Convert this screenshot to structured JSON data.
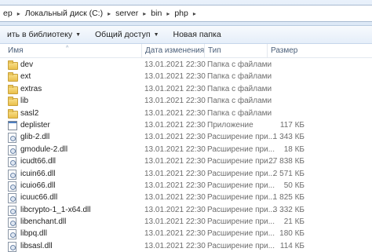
{
  "address": {
    "crumbs": [
      "ер",
      "Локальный диск (C:)",
      "server",
      "bin",
      "php"
    ],
    "dropdown": "▾"
  },
  "toolbar": {
    "library_label": "ить в библиотеку",
    "share_label": "Общий доступ",
    "new_folder_label": "Новая папка"
  },
  "columns": {
    "name": "Имя",
    "date": "Дата изменения",
    "type": "Тип",
    "size": "Размер"
  },
  "files": [
    {
      "name": "dev",
      "date": "13.01.2021 22:30",
      "type": "Папка с файлами",
      "size": "",
      "icon": "folder-icon"
    },
    {
      "name": "ext",
      "date": "13.01.2021 22:30",
      "type": "Папка с файлами",
      "size": "",
      "icon": "folder-icon"
    },
    {
      "name": "extras",
      "date": "13.01.2021 22:30",
      "type": "Папка с файлами",
      "size": "",
      "icon": "folder-icon"
    },
    {
      "name": "lib",
      "date": "13.01.2021 22:30",
      "type": "Папка с файлами",
      "size": "",
      "icon": "folder-icon"
    },
    {
      "name": "sasl2",
      "date": "13.01.2021 22:30",
      "type": "Папка с файлами",
      "size": "",
      "icon": "folder-icon"
    },
    {
      "name": "deplister",
      "date": "13.01.2021 22:30",
      "type": "Приложение",
      "size": "117 КБ",
      "icon": "application-icon"
    },
    {
      "name": "glib-2.dll",
      "date": "13.01.2021 22:30",
      "type": "Расширение при...",
      "size": "1 343 КБ",
      "icon": "dll-file-icon"
    },
    {
      "name": "gmodule-2.dll",
      "date": "13.01.2021 22:30",
      "type": "Расширение при...",
      "size": "18 КБ",
      "icon": "dll-file-icon"
    },
    {
      "name": "icudt66.dll",
      "date": "13.01.2021 22:30",
      "type": "Расширение при...",
      "size": "27 838 КБ",
      "icon": "dll-file-icon"
    },
    {
      "name": "icuin66.dll",
      "date": "13.01.2021 22:30",
      "type": "Расширение при...",
      "size": "2 571 КБ",
      "icon": "dll-file-icon"
    },
    {
      "name": "icuio66.dll",
      "date": "13.01.2021 22:30",
      "type": "Расширение при...",
      "size": "50 КБ",
      "icon": "dll-file-icon"
    },
    {
      "name": "icuuc66.dll",
      "date": "13.01.2021 22:30",
      "type": "Расширение при...",
      "size": "1 825 КБ",
      "icon": "dll-file-icon"
    },
    {
      "name": "libcrypto-1_1-x64.dll",
      "date": "13.01.2021 22:30",
      "type": "Расширение при...",
      "size": "3 332 КБ",
      "icon": "dll-file-icon"
    },
    {
      "name": "libenchant.dll",
      "date": "13.01.2021 22:30",
      "type": "Расширение при...",
      "size": "21 КБ",
      "icon": "dll-file-icon"
    },
    {
      "name": "libpq.dll",
      "date": "13.01.2021 22:30",
      "type": "Расширение при...",
      "size": "180 КБ",
      "icon": "dll-file-icon"
    },
    {
      "name": "libsasl.dll",
      "date": "13.01.2021 22:30",
      "type": "Расширение при...",
      "size": "114 КБ",
      "icon": "dll-file-icon"
    }
  ]
}
